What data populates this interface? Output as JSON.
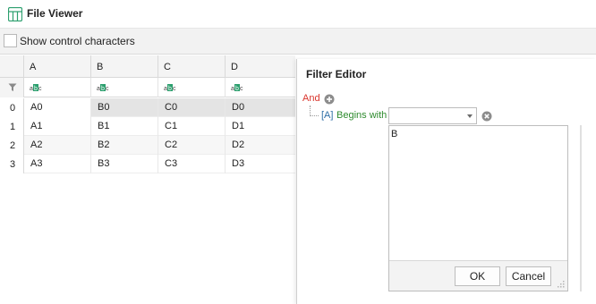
{
  "window": {
    "title": "File Viewer",
    "icon": "table-grid-icon",
    "accent": "#2c9f6e"
  },
  "options": {
    "show_control_chars_label": "Show control characters",
    "show_control_chars_checked": false
  },
  "grid": {
    "columns": [
      "A",
      "B",
      "C",
      "D"
    ],
    "filter_row_icon": "filter-icon",
    "filter_type_icon": "text-type-icon",
    "rows": [
      {
        "num": "0",
        "cells": [
          "A0",
          "B0",
          "C0",
          "D0"
        ],
        "selected": true
      },
      {
        "num": "1",
        "cells": [
          "A1",
          "B1",
          "C1",
          "D1"
        ],
        "selected": false
      },
      {
        "num": "2",
        "cells": [
          "A2",
          "B2",
          "C2",
          "D2"
        ],
        "selected": false
      },
      {
        "num": "3",
        "cells": [
          "A3",
          "B3",
          "C3",
          "D3"
        ],
        "selected": false
      }
    ]
  },
  "filter_editor": {
    "title": "Filter Editor",
    "group_operator": "And",
    "condition": {
      "field": "[A]",
      "operator": "Begins with",
      "value": ""
    },
    "popup_text": "B",
    "ok_label": "OK",
    "cancel_label": "Cancel",
    "colors": {
      "group": "#d9342b",
      "field": "#2e6ea6",
      "operator": "#2e8b2e"
    }
  }
}
